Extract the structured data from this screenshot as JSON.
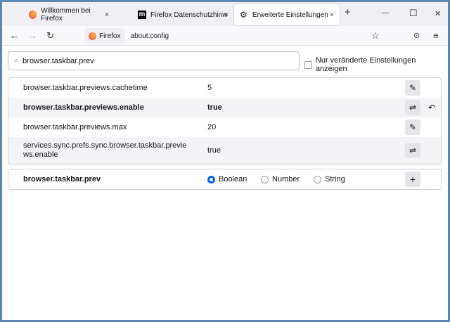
{
  "tabs": [
    {
      "label": "Willkommen bei Firefox",
      "icon": "firefox-icon"
    },
    {
      "label": "Firefox Datenschutzhinweis –",
      "icon": "mozilla-icon"
    },
    {
      "label": "Erweiterte Einstellungen",
      "icon": "gear-icon",
      "active": true
    }
  ],
  "tab_close": "×",
  "new_tab": "+",
  "window": {
    "minimize": "—",
    "maximize": "☐",
    "close": "✕"
  },
  "nav": {
    "back": "←",
    "forward": "→",
    "reload": "↻",
    "identity": "Firefox",
    "url": "about:config",
    "star": "☆",
    "pocket": "⊙",
    "menu": "≡"
  },
  "search": {
    "value": "browser.taskbar.prev",
    "icon": "⌕"
  },
  "modified_only_label": "Nur veränderte Einstellungen anzeigen",
  "prefs": [
    {
      "name": "browser.taskbar.previews.cachetime",
      "value": "5",
      "action": "✎",
      "bold": false
    },
    {
      "name": "browser.taskbar.previews.enable",
      "value": "true",
      "action": "⇌",
      "bold": true,
      "reset": "↶"
    },
    {
      "name": "browser.taskbar.previews.max",
      "value": "20",
      "action": "✎",
      "bold": false
    },
    {
      "name": "services.sync.prefs.sync.browser.taskbar.previews.enable",
      "value": "true",
      "action": "⇌",
      "bold": false
    }
  ],
  "add": {
    "name": "browser.taskbar.prev",
    "types": [
      "Boolean",
      "Number",
      "String"
    ],
    "selected": "Boolean",
    "button": "+"
  }
}
